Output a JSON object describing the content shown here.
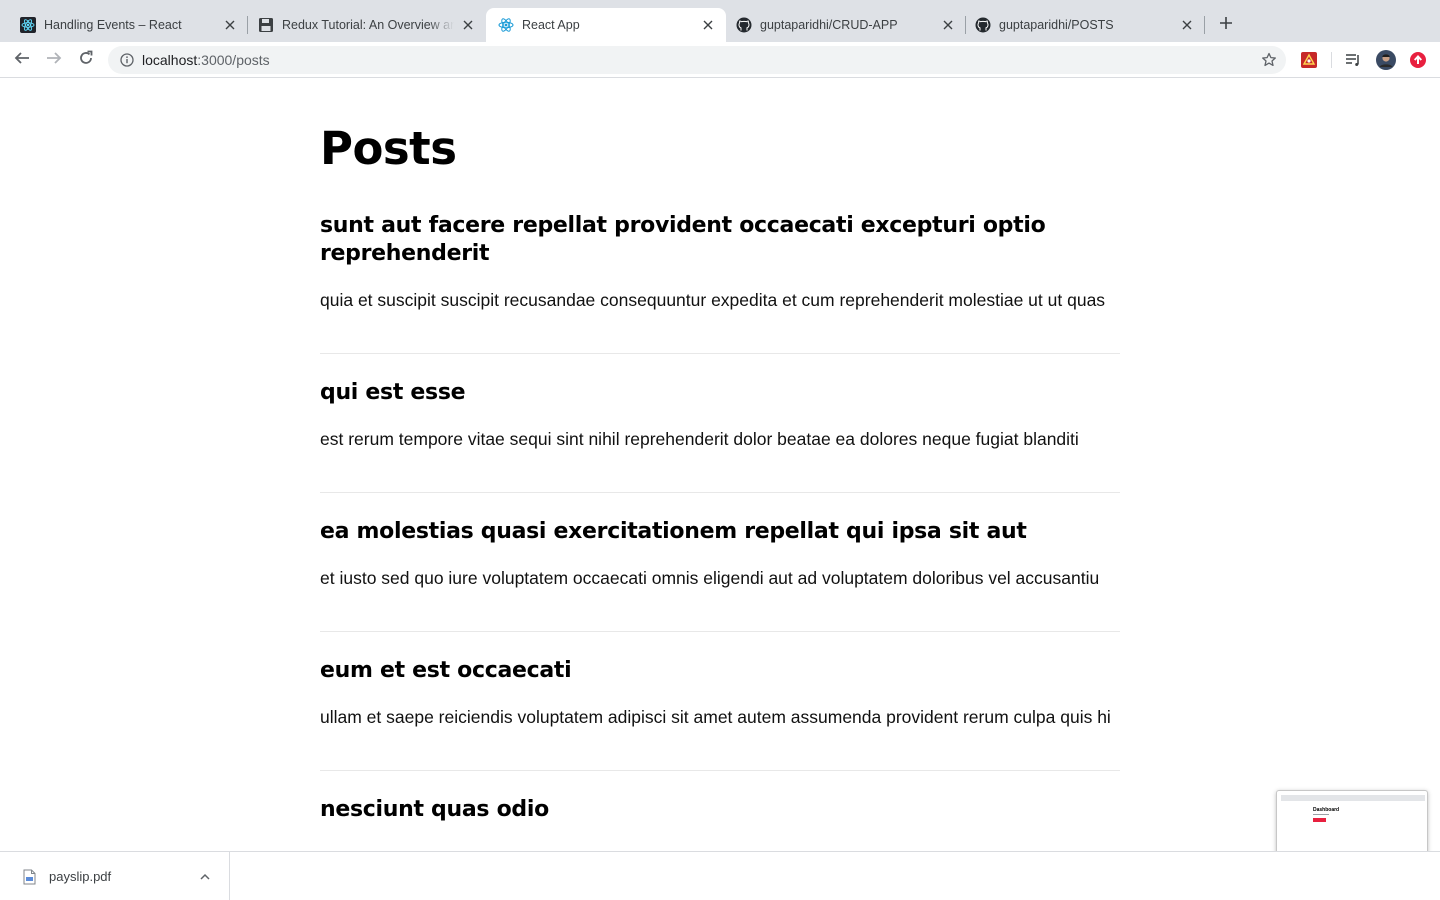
{
  "browser": {
    "tabs": [
      {
        "title": "Handling Events – React",
        "icon": "react-icon",
        "active": false
      },
      {
        "title": "Redux Tutorial: An Overview and...",
        "icon": "floppy-disk-icon",
        "active": false
      },
      {
        "title": "React App",
        "icon": "react-icon",
        "active": true
      },
      {
        "title": "guptaparidhi/CRUD-APP",
        "icon": "github-icon",
        "active": false
      },
      {
        "title": "guptaparidhi/POSTS",
        "icon": "github-icon",
        "active": false
      }
    ],
    "address": {
      "host": "localhost",
      "path": ":3000/posts"
    }
  },
  "page": {
    "title": "Posts",
    "posts": [
      {
        "title": "sunt aut facere repellat provident occaecati excepturi optio reprehenderit",
        "body": "quia et suscipit suscipit recusandae consequuntur expedita et cum reprehenderit molestiae ut ut quas"
      },
      {
        "title": "qui est esse",
        "body": "est rerum tempore vitae sequi sint nihil reprehenderit dolor beatae ea dolores neque fugiat blanditi"
      },
      {
        "title": "ea molestias quasi exercitationem repellat qui ipsa sit aut",
        "body": "et iusto sed quo iure voluptatem occaecati omnis eligendi aut ad voluptatem doloribus vel accusantiu"
      },
      {
        "title": "eum et est occaecati",
        "body": "ullam et saepe reiciendis voluptatem adipisci sit amet autem assumenda provident rerum culpa quis hi"
      },
      {
        "title": "nesciunt quas odio",
        "body": ""
      }
    ]
  },
  "downloads": {
    "items": [
      {
        "filename": "payslip.pdf"
      }
    ]
  },
  "preview": {
    "title": "Dashboard"
  },
  "colors": {
    "tabstrip": "#dee1e6",
    "omnibox": "#f1f3f4",
    "react": "#61dafb",
    "accent_red": "#e8203f"
  }
}
